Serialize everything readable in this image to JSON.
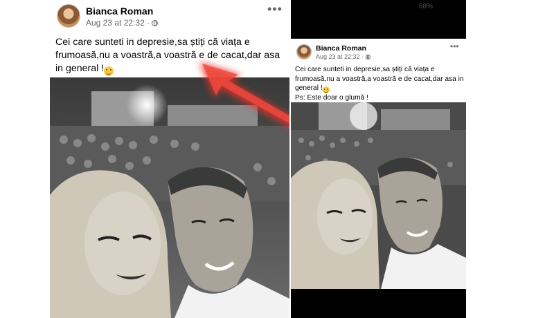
{
  "left_post": {
    "author": "Bianca Roman",
    "timestamp": "Aug 23 at 22:32",
    "separator": "·",
    "more_label": "•••",
    "text": "Cei care sunteti in depresie,sa știți că viața e frumoasă,nu a voastră,a voastră e de cacat,dar asa in general !"
  },
  "right_post": {
    "status_battery": "68%",
    "author": "Bianca Roman",
    "timestamp": "Aug 23 at 22:32",
    "separator": "·",
    "more_label": "•••",
    "text": "Cei care sunteti in depresie,sa știți că viața e frumoasă,nu a voastră,a voastră e de cacat,dar asa in general !",
    "ps": "Ps: Este doar o glumă !"
  },
  "colors": {
    "annotation_arrow": "#e8322c",
    "name_text": "#050505",
    "meta_text": "#65676b"
  },
  "icons": [
    "avatar",
    "globe-icon",
    "more-options-icon",
    "smiley-emoji",
    "red-arrow-annotation"
  ]
}
